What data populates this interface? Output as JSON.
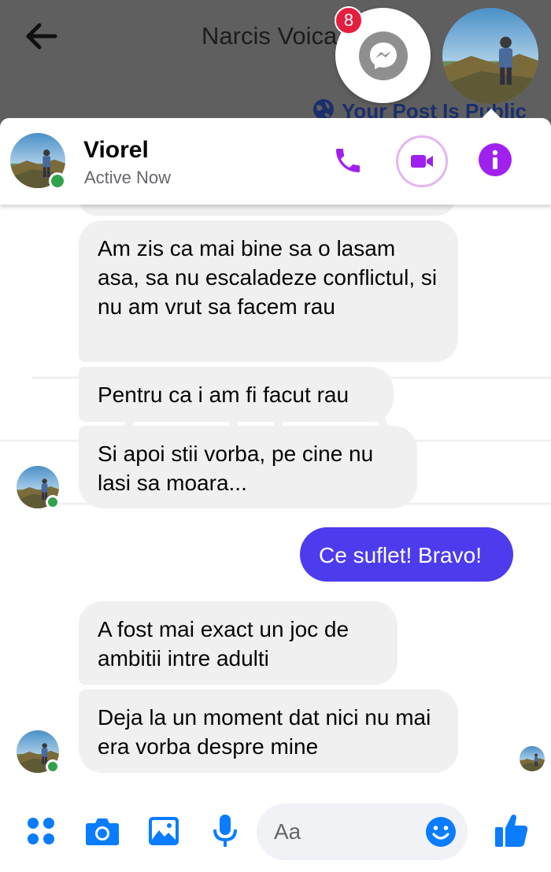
{
  "background_screen": {
    "title": "Narcis Voica",
    "subtitle": "Your Post Is Public"
  },
  "chat_heads": {
    "unread_badge": "8",
    "messenger_icon": "messenger-icon",
    "contact_avatar": "avatar"
  },
  "chat_header": {
    "contact_name": "Viorel",
    "status": "Active Now",
    "actions": [
      "phone-icon",
      "video-camera-icon",
      "info-icon"
    ]
  },
  "messages": [
    {
      "direction": "incoming",
      "text": "Am zis ca mai bine sa o lasam asa, sa nu escaladeze conflictul, si nu am vrut sa facem rau"
    },
    {
      "direction": "incoming",
      "text": "Pentru ca i am fi facut rau"
    },
    {
      "direction": "incoming",
      "text": "Si apoi stii vorba, pe cine nu lasi sa moara..."
    },
    {
      "direction": "outgoing",
      "text": "Ce suflet! Bravo!"
    },
    {
      "direction": "incoming",
      "text": "A fost mai exact un joc de ambitii intre adulti"
    },
    {
      "direction": "incoming",
      "text": "Deja la un moment dat nici nu mai era vorba despre mine"
    }
  ],
  "composer": {
    "placeholder": "Aa",
    "tools": [
      "apps-icon",
      "camera-icon",
      "image-icon",
      "microphone-icon",
      "emoji-icon",
      "thumbs-up-icon"
    ]
  },
  "colors": {
    "accent": "#a020f0",
    "outgoing_bubble": "#4d3bee",
    "incoming_bubble": "#f0f0f0",
    "online": "#31a24c",
    "badge": "#e41e3f",
    "toolbar_blue": "#0a7cff"
  }
}
